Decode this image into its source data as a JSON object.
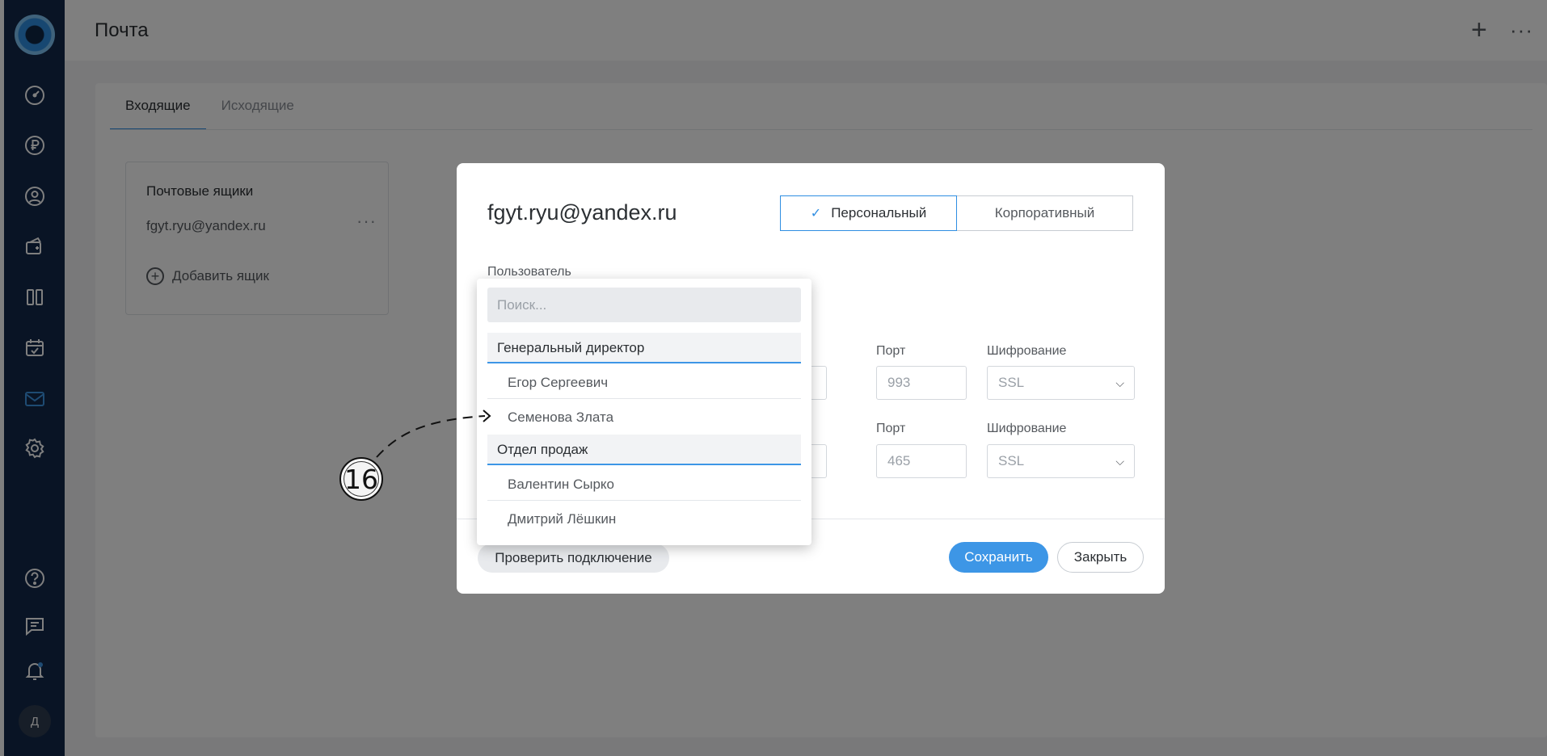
{
  "header": {
    "title": "Почта",
    "plus_icon": "plus-icon",
    "more_icon": "more-horizontal-icon",
    "plus_glyph": "+",
    "more_glyph": "···"
  },
  "sidebar": {
    "items": [
      {
        "name": "dashboard-icon"
      },
      {
        "name": "ruble-icon"
      },
      {
        "name": "user-circle-icon"
      },
      {
        "name": "deals-icon"
      },
      {
        "name": "kanban-icon"
      },
      {
        "name": "calendar-icon"
      },
      {
        "name": "mail-icon",
        "active": true
      },
      {
        "name": "settings-icon"
      },
      {
        "name": "help-icon"
      },
      {
        "name": "chat-icon"
      },
      {
        "name": "bell-icon"
      }
    ],
    "avatar": "Д",
    "accent": "#3d96e6"
  },
  "tabs": [
    {
      "label": "Входящие",
      "active": true
    },
    {
      "label": "Исходящие",
      "active": false
    }
  ],
  "mailboxes": {
    "title": "Почтовые ящики",
    "item": "fgyt.ryu@yandex.ru",
    "more": "···",
    "add_label": "Добавить ящик",
    "add_glyph": "+"
  },
  "modal": {
    "email": "fgyt.ryu@yandex.ru",
    "type_personal": "Персональный",
    "type_corporate": "Корпоративный",
    "check_glyph": "✓",
    "user_label": "Пользователь",
    "incoming": {
      "port_label": "Порт",
      "port": "993",
      "enc_label": "Шифрование",
      "enc": "SSL"
    },
    "outgoing": {
      "port_label": "Порт",
      "port": "465",
      "enc_label": "Шифрование",
      "enc": "SSL"
    },
    "chevron": "⌵",
    "check_button": "Проверить подключение",
    "save_button": "Сохранить",
    "close_button": "Закрыть"
  },
  "dropdown": {
    "search_placeholder": "Поиск...",
    "groups": [
      {
        "label": "Генеральный директор",
        "items": [
          "Егор Сергеевич",
          "Семенова Злата"
        ]
      },
      {
        "label": "Отдел продаж",
        "items": [
          "Валентин Сырко",
          "Дмитрий Лёшкин"
        ]
      }
    ]
  },
  "annotation": {
    "number": "16"
  }
}
